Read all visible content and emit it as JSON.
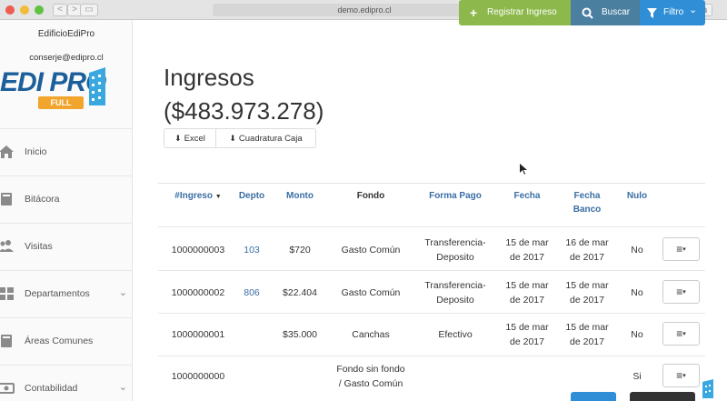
{
  "browser": {
    "url": "demo.edipro.cl",
    "reload_glyph": "↻",
    "back_glyph": "<",
    "forward_glyph": ">",
    "sidebar_glyph": "▭",
    "share_glyph": "⇪",
    "tabs_glyph": "⧉"
  },
  "sidebar": {
    "building": "EdificioEdiPro",
    "user": "conserje@edipro.cl",
    "logo_text": "EDI PRO",
    "logo_badge": "FULL",
    "items": [
      {
        "label": "Inicio",
        "icon": "home-icon",
        "chevron": ""
      },
      {
        "label": "Bitácora",
        "icon": "book-icon",
        "chevron": ""
      },
      {
        "label": "Visitas",
        "icon": "users-icon",
        "chevron": ""
      },
      {
        "label": "Departamentos",
        "icon": "grid-icon",
        "chevron": "⌄"
      },
      {
        "label": "Áreas Comunes",
        "icon": "book-icon",
        "chevron": ""
      },
      {
        "label": "Contabilidad",
        "icon": "money-icon",
        "chevron": "⌄"
      }
    ]
  },
  "main": {
    "title": "Ingresos",
    "total": "($483.973.278)",
    "export_excel": "Excel",
    "export_cuadratura": "Cuadratura Caja",
    "buttons": {
      "registrar": "Registrar Ingreso",
      "registrar_icon": "+",
      "buscar": "Buscar",
      "filtro": "Filtro",
      "filtro_caret": "⌄"
    }
  },
  "table": {
    "headers": {
      "ingreso": "#Ingreso",
      "sort": "▼",
      "depto": "Depto",
      "monto": "Monto",
      "fondo": "Fondo",
      "forma_pago": "Forma Pago",
      "fecha": "Fecha",
      "fecha_banco_1": "Fecha",
      "fecha_banco_2": "Banco",
      "nulo": "Nulo"
    },
    "rows": [
      {
        "ingreso": "1000000003",
        "depto": "103",
        "monto": "$720",
        "fondo_1": "Gasto Común",
        "fondo_2": "",
        "forma_1": "Transferencia-",
        "forma_2": "Deposito",
        "fecha_1": "15 de mar",
        "fecha_2": "de 2017",
        "banco_1": "16 de mar",
        "banco_2": "de 2017",
        "nulo": "No"
      },
      {
        "ingreso": "1000000002",
        "depto": "806",
        "monto": "$22.404",
        "fondo_1": "Gasto Común",
        "fondo_2": "",
        "forma_1": "Transferencia-",
        "forma_2": "Deposito",
        "fecha_1": "15 de mar",
        "fecha_2": "de 2017",
        "banco_1": "15 de mar",
        "banco_2": "de 2017",
        "nulo": "No"
      },
      {
        "ingreso": "1000000001",
        "depto": "",
        "monto": "$35.000",
        "fondo_1": "Canchas",
        "fondo_2": "",
        "forma_1": "Efectivo",
        "forma_2": "",
        "fecha_1": "15 de mar",
        "fecha_2": "de 2017",
        "banco_1": "15 de mar",
        "banco_2": "de 2017",
        "nulo": "No"
      },
      {
        "ingreso": "1000000000",
        "depto": "",
        "monto": "",
        "fondo_1": "Fondo sin fondo",
        "fondo_2": "/ Gasto Común",
        "forma_1": "",
        "forma_2": "",
        "fecha_1": "",
        "fecha_2": "",
        "banco_1": "",
        "banco_2": "",
        "nulo": "Si"
      }
    ],
    "menu_glyph": "≡",
    "menu_caret": "▾"
  }
}
